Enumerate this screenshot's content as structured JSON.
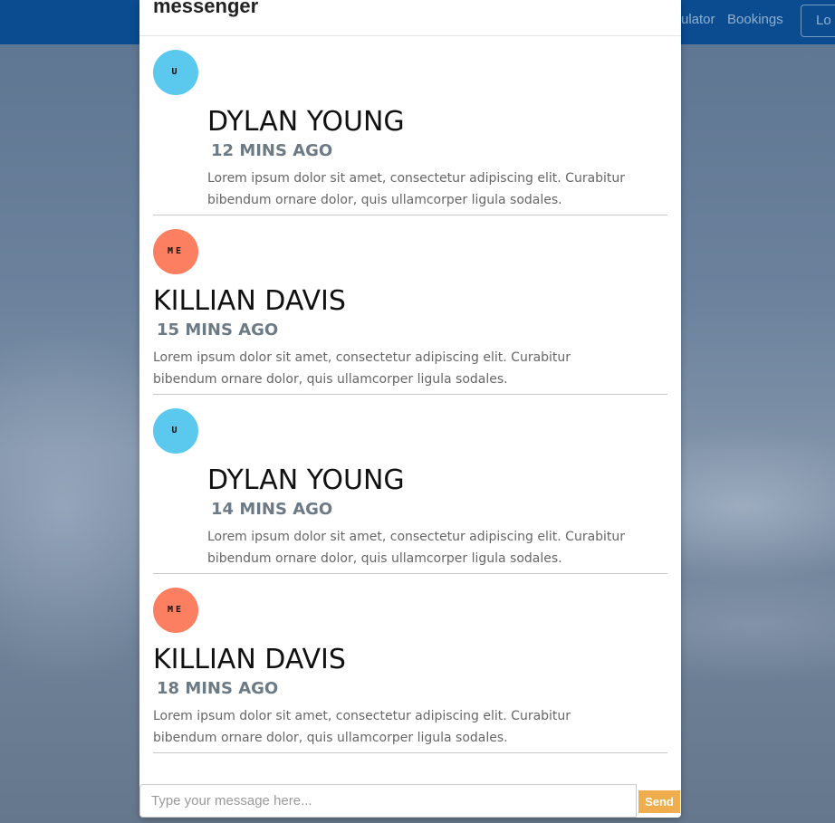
{
  "navbar": {
    "calculator_label": "ulator",
    "bookings_label": "Bookings",
    "login_label": "Lo"
  },
  "modal": {
    "title": "messenger"
  },
  "messages": [
    {
      "avatar_initials": "U",
      "avatar_color": "#5bc8ee",
      "name": "DYLAN YOUNG",
      "time": "12 MINS AGO",
      "text": "Lorem ipsum dolor sit amet, consectetur adipiscing elit. Curabitur bibendum ornare dolor, quis ullamcorper ligula sodales."
    },
    {
      "avatar_initials": "ME",
      "avatar_color": "#fd7f61",
      "name": "KILLIAN DAVIS",
      "time": "15 MINS AGO",
      "text": "Lorem ipsum dolor sit amet, consectetur adipiscing elit. Curabitur bibendum ornare dolor, quis ullamcorper ligula sodales."
    },
    {
      "avatar_initials": "U",
      "avatar_color": "#5bc8ee",
      "name": "DYLAN YOUNG",
      "time": "14 MINS AGO",
      "text": "Lorem ipsum dolor sit amet, consectetur adipiscing elit. Curabitur bibendum ornare dolor, quis ullamcorper ligula sodales."
    },
    {
      "avatar_initials": "ME",
      "avatar_color": "#fd7f61",
      "name": "KILLIAN DAVIS",
      "time": "18 MINS AGO",
      "text": "Lorem ipsum dolor sit amet, consectetur adipiscing elit. Curabitur bibendum ornare dolor, quis ullamcorper ligula sodales."
    }
  ],
  "composer": {
    "placeholder": "Type your message here...",
    "value": "",
    "send_label": "Send"
  },
  "colors": {
    "navbar": "#0a4c8f",
    "send_button": "#f0ad4e",
    "user_avatar": "#5bc8ee",
    "me_avatar": "#fd7f61",
    "timestamp": "#6c7a86"
  }
}
